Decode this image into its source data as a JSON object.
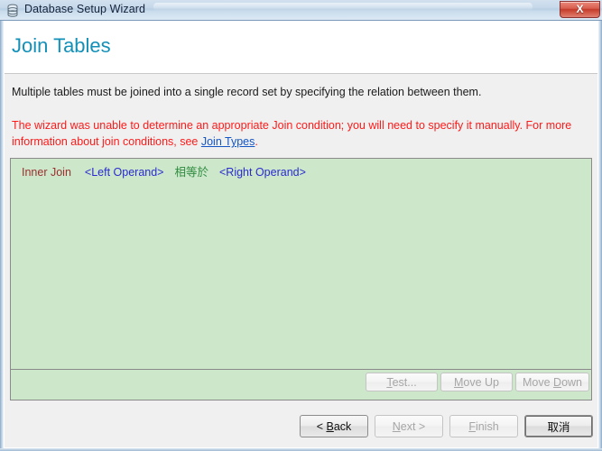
{
  "window": {
    "title": "Database Setup Wizard",
    "icon": "database-icon",
    "close_label": "X"
  },
  "header": {
    "heading": "Join Tables",
    "heading_color": "#1390b8"
  },
  "body": {
    "intro": "Multiple tables must be joined into a single record set by specifying the relation between them.",
    "warning_part1": "The wizard was unable to determine an appropriate Join condition; you will need to specify it manually.  For more information about join conditions, see ",
    "warning_link": "Join Types",
    "warning_part2": ".",
    "warning_color": "#ff1a1a",
    "link_color": "#1455c4"
  },
  "join_panel": {
    "background_color": "#cce7ca",
    "rows": [
      {
        "join_type": "Inner Join",
        "left_operand": "<Left Operand>",
        "operator": "相等於",
        "right_operand": "<Right Operand>",
        "join_type_color": "#9b2f2f",
        "operand_color": "#2b2bd0",
        "operator_color": "#2f8b3f"
      }
    ],
    "actions": [
      {
        "label": "Test...",
        "accel": "T",
        "enabled": false
      },
      {
        "label": "Move Up",
        "accel": "M",
        "enabled": false
      },
      {
        "label": "Move Down",
        "accel": "D",
        "enabled": false
      }
    ]
  },
  "navigation": {
    "buttons": [
      {
        "label": "< Back",
        "accel": "B",
        "enabled": true,
        "default": false
      },
      {
        "label": "Next >",
        "accel": "N",
        "enabled": false,
        "default": false
      },
      {
        "label": "Finish",
        "accel": "F",
        "enabled": false,
        "default": false
      },
      {
        "label": "取消",
        "accel": "",
        "enabled": true,
        "default": true
      }
    ]
  }
}
